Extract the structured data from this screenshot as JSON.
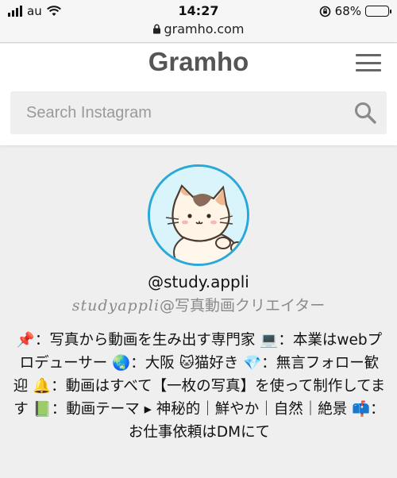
{
  "status_bar": {
    "carrier": "au",
    "time": "14:27",
    "battery": "68%",
    "battery_level": 0.68,
    "url": "gramho.com"
  },
  "header": {
    "logo": "Gramho",
    "search_placeholder": "Search Instagram"
  },
  "profile": {
    "username": "@study.appli",
    "fullname_script": "studyappli",
    "fullname_rest": "@写真動画クリエイター",
    "bio": "📌：写真から動画を生み出す専門家 💻：本業はwebプロデューサー 🌏：大阪 🐱猫好き 💎：無言フォロー歓迎 🔔：動画はすべて【一枚の写真】を使って制作してます 📗：動画テーマ ▸ 神秘的｜鮮やか｜自然｜絶景 📫：お仕事依頼はDMにて"
  },
  "colors": {
    "accent_ring": "#2aa8d8",
    "logo": "#555555",
    "page_bg": "#efefef"
  }
}
